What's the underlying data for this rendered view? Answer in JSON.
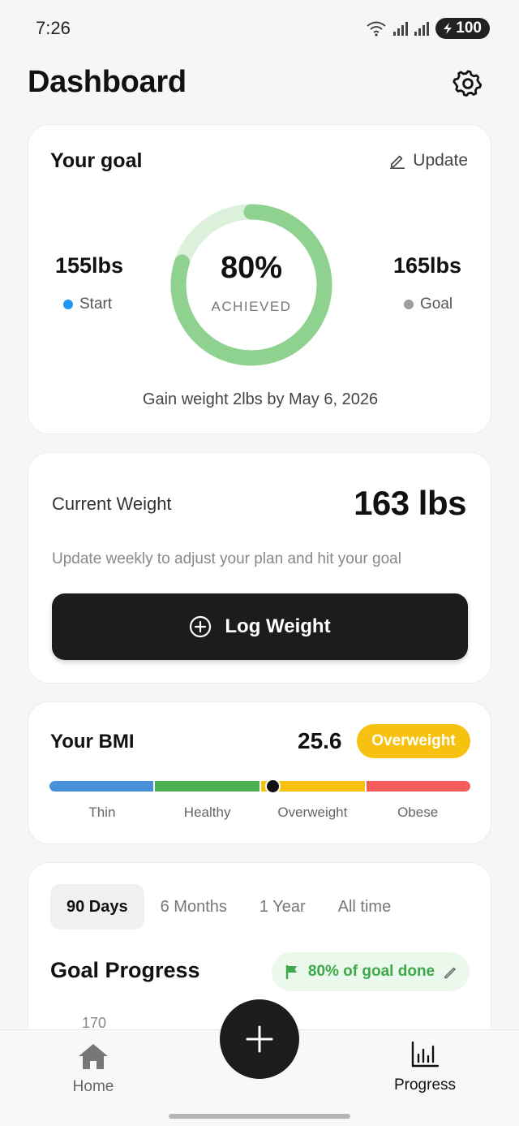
{
  "status_bar": {
    "time": "7:26",
    "battery": "100"
  },
  "header": {
    "title": "Dashboard"
  },
  "goal_card": {
    "title": "Your goal",
    "update_label": "Update",
    "start_value": "155lbs",
    "start_label": "Start",
    "goal_value": "165lbs",
    "goal_label": "Goal",
    "progress_percent": "80%",
    "progress_fraction": 0.8,
    "progress_caption": "ACHIEVED",
    "note": "Gain weight 2lbs by May 6, 2026"
  },
  "weight_card": {
    "label": "Current Weight",
    "value": "163 lbs",
    "hint": "Update weekly to adjust your plan and hit your goal",
    "log_button": "Log Weight"
  },
  "bmi_card": {
    "title": "Your BMI",
    "value": "25.6",
    "category": "Overweight",
    "marker_fraction": 0.53,
    "ranges": [
      {
        "label": "Thin",
        "color": "#4a90d9"
      },
      {
        "label": "Healthy",
        "color": "#4caf50"
      },
      {
        "label": "Overweight",
        "color": "#f7c20f"
      },
      {
        "label": "Obese",
        "color": "#f55c5c"
      }
    ]
  },
  "progress_card": {
    "tabs": [
      {
        "label": "90 Days",
        "active": true
      },
      {
        "label": "6 Months",
        "active": false
      },
      {
        "label": "1 Year",
        "active": false
      },
      {
        "label": "All time",
        "active": false
      }
    ],
    "title": "Goal Progress",
    "badge": "80% of goal done",
    "y_tick_top": "170"
  },
  "bottom_nav": {
    "home_label": "Home",
    "progress_label": "Progress"
  },
  "colors": {
    "ring": "#8fd18f",
    "ring_track": "#dcf1dc",
    "start_dot": "#2196f3",
    "goal_dot": "#9e9e9e",
    "accent_green": "#3ea84a",
    "badge_yellow": "#f7c20f"
  }
}
